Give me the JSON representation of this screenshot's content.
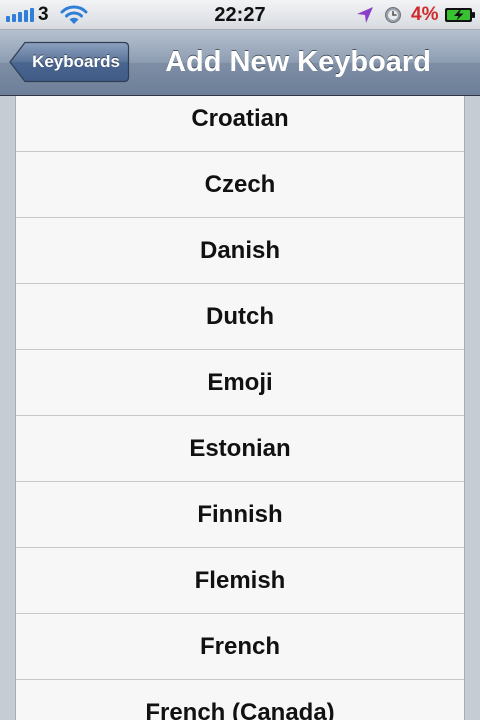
{
  "status_bar": {
    "carrier": "3",
    "time": "22:27",
    "battery_percent": "4%",
    "signal_bars": 5,
    "icons": [
      "signal-icon",
      "wifi-icon",
      "location-arrow-icon",
      "rotation-lock-icon",
      "battery-charging-icon"
    ],
    "colors": {
      "signal": "#2f7fd8",
      "location": "#8b3fc8",
      "battery_text": "#d02a2a",
      "battery_fill": "#38c231"
    }
  },
  "nav": {
    "back_label": "Keyboards",
    "title": "Add New Keyboard"
  },
  "keyboards": {
    "items": [
      "Croatian",
      "Czech",
      "Danish",
      "Dutch",
      "Emoji",
      "Estonian",
      "Finnish",
      "Flemish",
      "French",
      "French (Canada)"
    ]
  }
}
